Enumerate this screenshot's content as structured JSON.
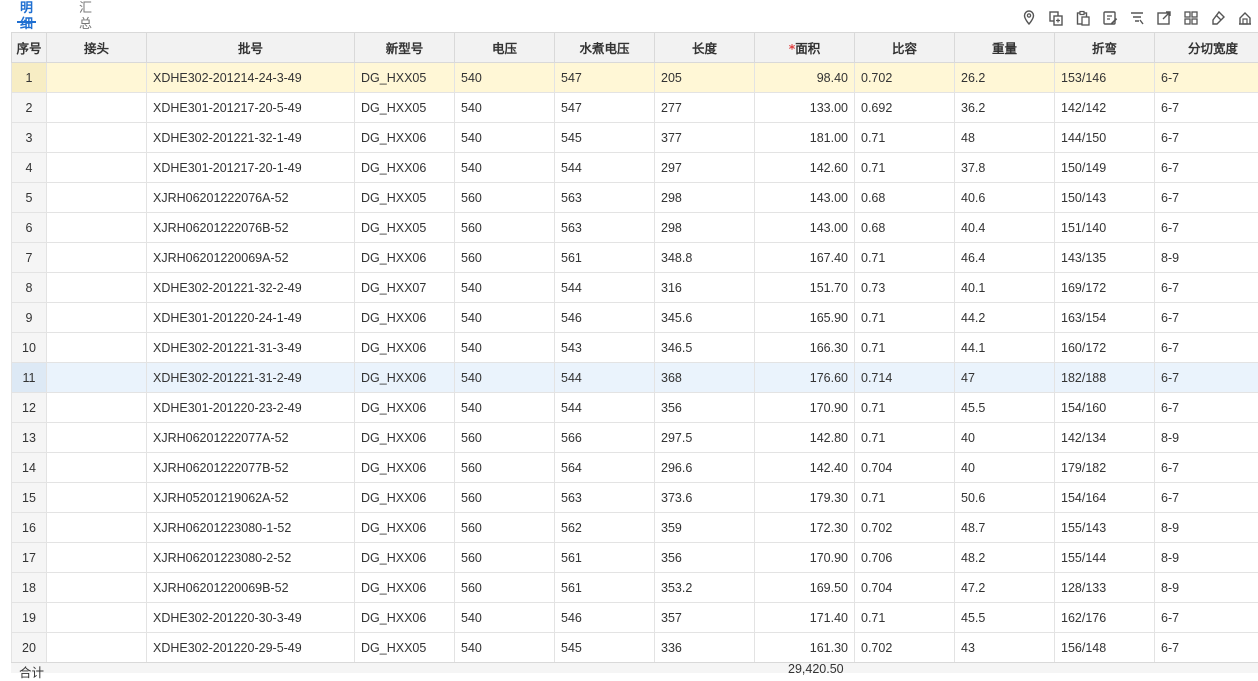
{
  "tabs": [
    {
      "label": "明细",
      "active": true
    },
    {
      "label": "汇总",
      "active": false
    }
  ],
  "toolbar": {
    "icons": [
      "location-icon",
      "copy-row-icon",
      "paste-icon",
      "batch-edit-icon",
      "filter-icon",
      "export-icon",
      "columns-icon",
      "eraser-icon",
      "more-icon"
    ]
  },
  "table": {
    "columns": [
      {
        "label": "序号",
        "required": false
      },
      {
        "label": "接头",
        "required": false
      },
      {
        "label": "批号",
        "required": false
      },
      {
        "label": "新型号",
        "required": false
      },
      {
        "label": "电压",
        "required": false
      },
      {
        "label": "水煮电压",
        "required": false
      },
      {
        "label": "长度",
        "required": false
      },
      {
        "label": "面积",
        "required": true
      },
      {
        "label": "比容",
        "required": false
      },
      {
        "label": "重量",
        "required": false
      },
      {
        "label": "折弯",
        "required": false
      },
      {
        "label": "分切宽度",
        "required": false
      }
    ],
    "rows": [
      {
        "seq": "1",
        "joint": "",
        "batch": "XDHE302-201214-24-3-49",
        "model": "DG_HXX05",
        "voltage": "540",
        "boil_voltage": "547",
        "length": "205",
        "area": "98.40",
        "capacity": "0.702",
        "weight": "26.2",
        "bend": "153/146",
        "width": "6-7"
      },
      {
        "seq": "2",
        "joint": "",
        "batch": "XDHE301-201217-20-5-49",
        "model": "DG_HXX05",
        "voltage": "540",
        "boil_voltage": "547",
        "length": "277",
        "area": "133.00",
        "capacity": "0.692",
        "weight": "36.2",
        "bend": "142/142",
        "width": "6-7"
      },
      {
        "seq": "3",
        "joint": "",
        "batch": "XDHE302-201221-32-1-49",
        "model": "DG_HXX06",
        "voltage": "540",
        "boil_voltage": "545",
        "length": "377",
        "area": "181.00",
        "capacity": "0.71",
        "weight": "48",
        "bend": "144/150",
        "width": "6-7"
      },
      {
        "seq": "4",
        "joint": "",
        "batch": "XDHE301-201217-20-1-49",
        "model": "DG_HXX06",
        "voltage": "540",
        "boil_voltage": "544",
        "length": "297",
        "area": "142.60",
        "capacity": "0.71",
        "weight": "37.8",
        "bend": "150/149",
        "width": "6-7"
      },
      {
        "seq": "5",
        "joint": "",
        "batch": "XJRH06201222076A-52",
        "model": "DG_HXX05",
        "voltage": "560",
        "boil_voltage": "563",
        "length": "298",
        "area": "143.00",
        "capacity": "0.68",
        "weight": "40.6",
        "bend": "150/143",
        "width": "6-7"
      },
      {
        "seq": "6",
        "joint": "",
        "batch": "XJRH06201222076B-52",
        "model": "DG_HXX05",
        "voltage": "560",
        "boil_voltage": "563",
        "length": "298",
        "area": "143.00",
        "capacity": "0.68",
        "weight": "40.4",
        "bend": "151/140",
        "width": "6-7"
      },
      {
        "seq": "7",
        "joint": "",
        "batch": "XJRH06201220069A-52",
        "model": "DG_HXX06",
        "voltage": "560",
        "boil_voltage": "561",
        "length": "348.8",
        "area": "167.40",
        "capacity": "0.71",
        "weight": "46.4",
        "bend": "143/135",
        "width": "8-9"
      },
      {
        "seq": "8",
        "joint": "",
        "batch": "XDHE302-201221-32-2-49",
        "model": "DG_HXX07",
        "voltage": "540",
        "boil_voltage": "544",
        "length": "316",
        "area": "151.70",
        "capacity": "0.73",
        "weight": "40.1",
        "bend": "169/172",
        "width": "6-7"
      },
      {
        "seq": "9",
        "joint": "",
        "batch": "XDHE301-201220-24-1-49",
        "model": "DG_HXX06",
        "voltage": "540",
        "boil_voltage": "546",
        "length": "345.6",
        "area": "165.90",
        "capacity": "0.71",
        "weight": "44.2",
        "bend": "163/154",
        "width": "6-7"
      },
      {
        "seq": "10",
        "joint": "",
        "batch": "XDHE302-201221-31-3-49",
        "model": "DG_HXX06",
        "voltage": "540",
        "boil_voltage": "543",
        "length": "346.5",
        "area": "166.30",
        "capacity": "0.71",
        "weight": "44.1",
        "bend": "160/172",
        "width": "6-7"
      },
      {
        "seq": "11",
        "joint": "",
        "batch": "XDHE302-201221-31-2-49",
        "model": "DG_HXX06",
        "voltage": "540",
        "boil_voltage": "544",
        "length": "368",
        "area": "176.60",
        "capacity": "0.714",
        "weight": "47",
        "bend": "182/188",
        "width": "6-7"
      },
      {
        "seq": "12",
        "joint": "",
        "batch": "XDHE301-201220-23-2-49",
        "model": "DG_HXX06",
        "voltage": "540",
        "boil_voltage": "544",
        "length": "356",
        "area": "170.90",
        "capacity": "0.71",
        "weight": "45.5",
        "bend": "154/160",
        "width": "6-7"
      },
      {
        "seq": "13",
        "joint": "",
        "batch": "XJRH06201222077A-52",
        "model": "DG_HXX06",
        "voltage": "560",
        "boil_voltage": "566",
        "length": "297.5",
        "area": "142.80",
        "capacity": "0.71",
        "weight": "40",
        "bend": "142/134",
        "width": "8-9"
      },
      {
        "seq": "14",
        "joint": "",
        "batch": "XJRH06201222077B-52",
        "model": "DG_HXX06",
        "voltage": "560",
        "boil_voltage": "564",
        "length": "296.6",
        "area": "142.40",
        "capacity": "0.704",
        "weight": "40",
        "bend": "179/182",
        "width": "6-7"
      },
      {
        "seq": "15",
        "joint": "",
        "batch": "XJRH05201219062A-52",
        "model": "DG_HXX06",
        "voltage": "560",
        "boil_voltage": "563",
        "length": "373.6",
        "area": "179.30",
        "capacity": "0.71",
        "weight": "50.6",
        "bend": "154/164",
        "width": "6-7"
      },
      {
        "seq": "16",
        "joint": "",
        "batch": "XJRH06201223080-1-52",
        "model": "DG_HXX06",
        "voltage": "560",
        "boil_voltage": "562",
        "length": "359",
        "area": "172.30",
        "capacity": "0.702",
        "weight": "48.7",
        "bend": "155/143",
        "width": "8-9"
      },
      {
        "seq": "17",
        "joint": "",
        "batch": "XJRH06201223080-2-52",
        "model": "DG_HXX06",
        "voltage": "560",
        "boil_voltage": "561",
        "length": "356",
        "area": "170.90",
        "capacity": "0.706",
        "weight": "48.2",
        "bend": "155/144",
        "width": "8-9"
      },
      {
        "seq": "18",
        "joint": "",
        "batch": "XJRH06201220069B-52",
        "model": "DG_HXX06",
        "voltage": "560",
        "boil_voltage": "561",
        "length": "353.2",
        "area": "169.50",
        "capacity": "0.704",
        "weight": "47.2",
        "bend": "128/133",
        "width": "8-9"
      },
      {
        "seq": "19",
        "joint": "",
        "batch": "XDHE302-201220-30-3-49",
        "model": "DG_HXX06",
        "voltage": "540",
        "boil_voltage": "546",
        "length": "357",
        "area": "171.40",
        "capacity": "0.71",
        "weight": "45.5",
        "bend": "162/176",
        "width": "6-7"
      },
      {
        "seq": "20",
        "joint": "",
        "batch": "XDHE302-201220-29-5-49",
        "model": "DG_HXX05",
        "voltage": "540",
        "boil_voltage": "545",
        "length": "336",
        "area": "161.30",
        "capacity": "0.702",
        "weight": "43",
        "bend": "156/148",
        "width": "6-7"
      }
    ],
    "selected_row": 1,
    "hover_row": 11
  },
  "footer": {
    "label": "合计",
    "area_total": "29,420.50"
  },
  "colors": {
    "accent": "#1f6fd1",
    "selected_row": "#fff7d6",
    "hover_row": "#eaf3fc",
    "required_mark": "#e04040"
  }
}
